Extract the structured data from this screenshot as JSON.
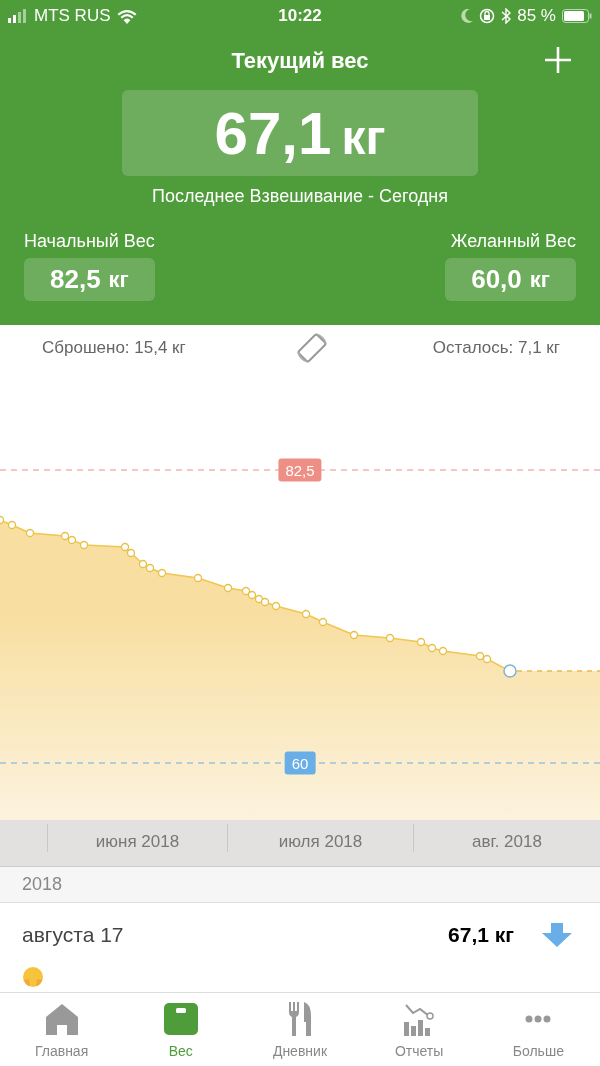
{
  "status_bar": {
    "carrier": "MTS RUS",
    "time": "10:22",
    "battery": "85 %"
  },
  "header": {
    "title": "Текущий вес",
    "current": {
      "value": "67,1",
      "unit": "кг"
    },
    "last_weighing": "Последнее Взвешивание - Сегодня",
    "start": {
      "label": "Начальный Вес",
      "value": "82,5",
      "unit": "кг"
    },
    "target": {
      "label": "Желанный Вес",
      "value": "60,0",
      "unit": "кг"
    }
  },
  "summary": {
    "lost": "Сброшено: 15,4 кг",
    "remaining": "Осталось: 7,1 кг"
  },
  "chart": {
    "reference_lines": [
      {
        "kind": "start",
        "label": "82,5"
      },
      {
        "kind": "goal",
        "label": "60"
      }
    ],
    "months": [
      "июня 2018",
      "июля 2018",
      "авг. 2018"
    ]
  },
  "history": {
    "year": "2018",
    "entries": [
      {
        "date": "августа 17",
        "weight": "67,1 кг",
        "kind": "down"
      }
    ]
  },
  "tabs": [
    {
      "label": "Главная",
      "selected": false
    },
    {
      "label": "Вес",
      "selected": true
    },
    {
      "label": "Дневник",
      "selected": false
    },
    {
      "label": "Отчеты",
      "selected": false
    },
    {
      "label": "Больше",
      "selected": false
    }
  ]
}
